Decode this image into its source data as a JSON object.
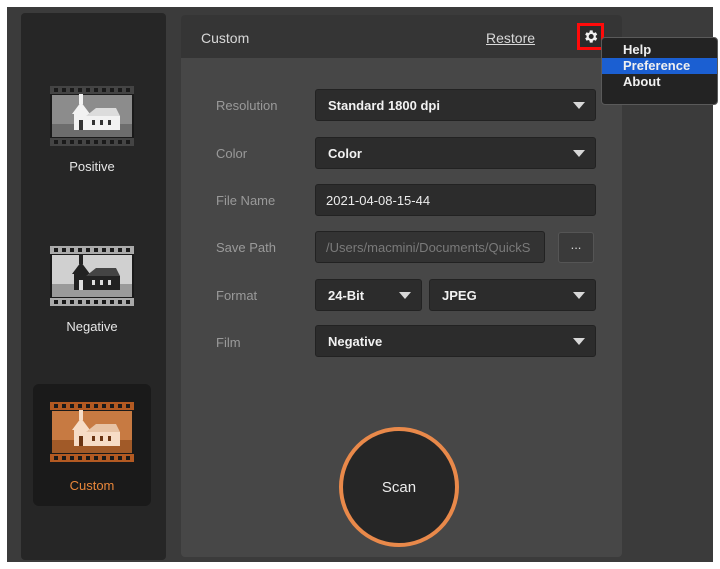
{
  "sidebar": {
    "modes": [
      {
        "label": "Positive",
        "icon": "positive-film-icon",
        "active": false
      },
      {
        "label": "Negative",
        "icon": "negative-film-icon",
        "active": false
      },
      {
        "label": "Custom",
        "icon": "custom-film-icon",
        "active": true
      }
    ]
  },
  "header": {
    "title": "Custom",
    "restore_label": "Restore",
    "settings_icon": "gear-icon"
  },
  "settings_menu": {
    "items": [
      {
        "label": "Help",
        "highlighted": false
      },
      {
        "label": "Preference",
        "highlighted": true
      },
      {
        "label": "About",
        "highlighted": false
      }
    ]
  },
  "form": {
    "resolution": {
      "label": "Resolution",
      "value": "Standard 1800 dpi"
    },
    "color": {
      "label": "Color",
      "value": "Color"
    },
    "file_name": {
      "label": "File Name",
      "value": "2021-04-08-15-44"
    },
    "save_path": {
      "label": "Save Path",
      "value": "/Users/macmini/Documents/QuickS",
      "browse_label": "..."
    },
    "format": {
      "label": "Format",
      "bit_depth": "24-Bit",
      "file_type": "JPEG"
    },
    "film": {
      "label": "Film",
      "value": "Negative"
    }
  },
  "scan_button": {
    "label": "Scan"
  },
  "colors": {
    "accent": "#e9894a",
    "highlight": "#ff0a0a",
    "menu_selection": "#1b5fd2"
  }
}
